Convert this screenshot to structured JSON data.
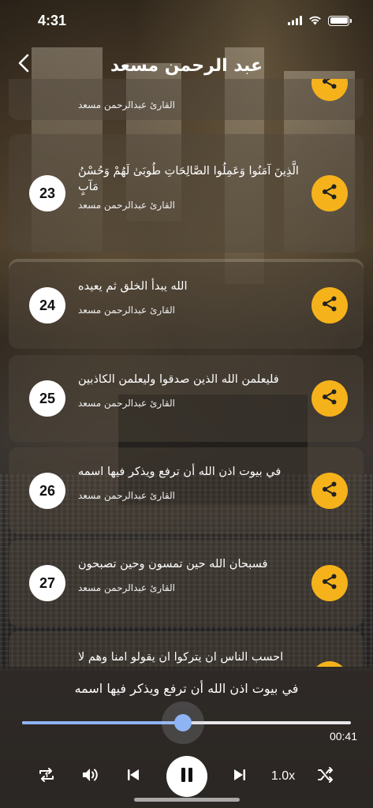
{
  "status_bar": {
    "time": "4:31"
  },
  "nav": {
    "title": "عبد الرحمن مسعد"
  },
  "items": [
    {
      "number": "",
      "text": "",
      "reciter": "القارئ عبدالرحمن مسعد"
    },
    {
      "number": "23",
      "text": "الَّذِينَ آمَنُوا وَعَمِلُوا الصَّالِحَاتِ طُوبَىٰ لَهُمْ وَحُسْنُ مَآبٍ",
      "reciter": "القارئ عبدالرحمن مسعد"
    },
    {
      "number": "24",
      "text": "الله يبدأ الخلق ثم يعيده",
      "reciter": "القارئ عبدالرحمن مسعد"
    },
    {
      "number": "25",
      "text": "فليعلمن الله الذين صدقوا وليعلمن الكاذبين",
      "reciter": "القارئ عبدالرحمن مسعد"
    },
    {
      "number": "26",
      "text": "في بيوت اذن الله أن ترفع ويذكر فيها اسمه",
      "reciter": "القارئ عبدالرحمن مسعد"
    },
    {
      "number": "27",
      "text": "فسبحان الله حين تمسون وحين تصبحون",
      "reciter": "القارئ عبدالرحمن مسعد"
    },
    {
      "number": "",
      "text": "احسب الناس ان يتركوا ان يقولو امنا وهم لا",
      "reciter": ""
    }
  ],
  "player": {
    "now_playing": "في بيوت اذن الله أن ترفع ويذكر فيها اسمه",
    "progress": 0.49,
    "duration": "00:41",
    "speed": "1.0x"
  },
  "colors": {
    "accent": "#f5b21b",
    "progress": "#8eb4f6"
  },
  "icons": [
    "back-chevron-icon",
    "share-icon",
    "repeat-one-icon",
    "volume-icon",
    "skip-previous-icon",
    "pause-icon",
    "skip-next-icon",
    "shuffle-icon",
    "wifi-icon",
    "battery-icon",
    "signal-icon"
  ]
}
